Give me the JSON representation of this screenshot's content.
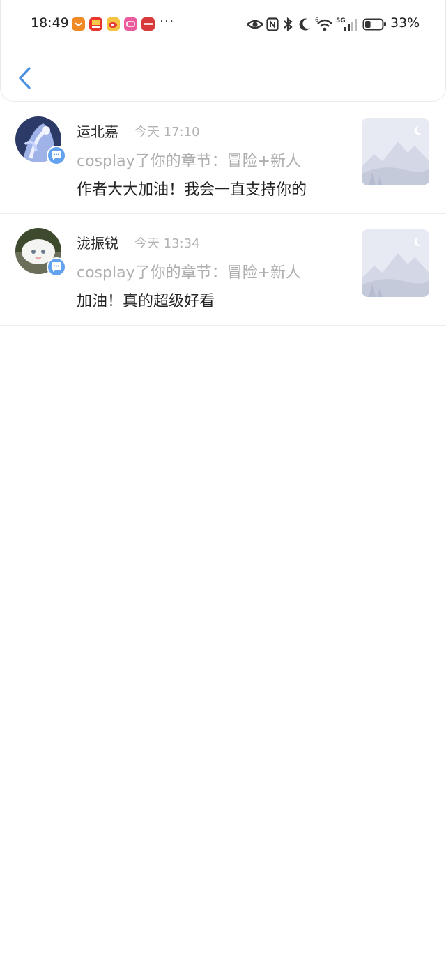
{
  "status_bar": {
    "time": "18:49",
    "more": "···",
    "battery_percent": "33%",
    "battery_level": 0.33,
    "signal_label": "5G",
    "icons": [
      "eye-icon",
      "nfc-icon",
      "bluetooth-icon",
      "moon-icon",
      "wifi-icon",
      "signal-icon",
      "battery-icon"
    ],
    "app_icons": [
      "app-icon-orange",
      "app-icon-red-news",
      "app-icon-weibo",
      "app-icon-pink",
      "app-icon-huawei"
    ]
  },
  "header": {
    "back_icon": "chevron-left-icon",
    "accent_color": "#4a90e2"
  },
  "messages": [
    {
      "user": "运北嘉",
      "time": "今天 17:10",
      "action": "cosplay了你的章节：冒险+新人",
      "comment": "作者大大加油！我会一直支持你的"
    },
    {
      "user": "泷振锐",
      "time": "今天 13:34",
      "action": "cosplay了你的章节：冒险+新人",
      "comment": "加油！真的超级好看"
    }
  ],
  "colors": {
    "badge": "#62a2ee",
    "muted_text": "#aeaeae",
    "primary_text": "#222222"
  }
}
